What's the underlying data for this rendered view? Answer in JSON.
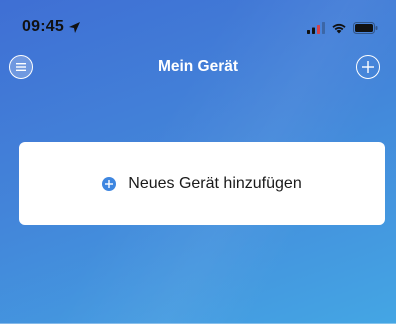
{
  "status_bar": {
    "time": "09:45",
    "icons": [
      "location-arrow-icon",
      "cellular-signal-icon",
      "wifi-icon",
      "battery-icon"
    ]
  },
  "nav": {
    "title": "Mein Gerät",
    "left_icon": "menu-icon",
    "right_icon": "plus-icon"
  },
  "card": {
    "label": "Neues Gerät hinzufügen",
    "icon": "plus-circle-icon",
    "accent_color": "#3e86e0"
  },
  "colors": {
    "background_top": "#3f6fd4",
    "background_bottom": "#44a6e4",
    "card": "#ffffff"
  }
}
